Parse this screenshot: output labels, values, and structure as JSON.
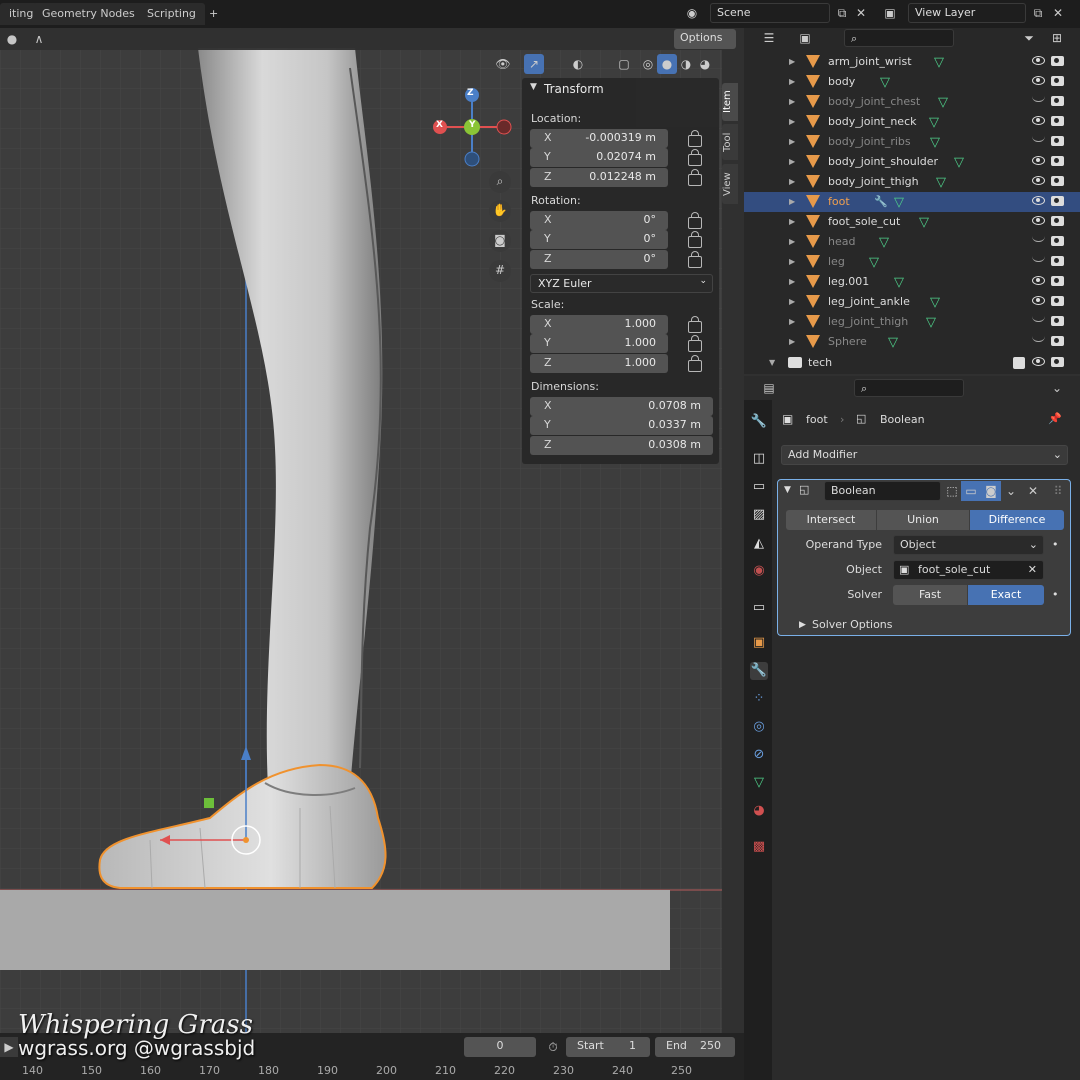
{
  "workspace_tabs": [
    "iting",
    "Geometry Nodes",
    "Scripting",
    "+"
  ],
  "scene": {
    "label": "Scene",
    "view_layer": "View Layer"
  },
  "viewport": {
    "options_label": "Options",
    "tabs": [
      "Item",
      "Tool",
      "View"
    ],
    "gizmo": {
      "z": "Z",
      "y": "Y",
      "x": "X"
    }
  },
  "transform": {
    "title": "Transform",
    "location_label": "Location:",
    "location": [
      {
        "axis": "X",
        "value": "-0.000319 m"
      },
      {
        "axis": "Y",
        "value": "0.02074 m"
      },
      {
        "axis": "Z",
        "value": "0.012248 m"
      }
    ],
    "rotation_label": "Rotation:",
    "rotation": [
      {
        "axis": "X",
        "value": "0°"
      },
      {
        "axis": "Y",
        "value": "0°"
      },
      {
        "axis": "Z",
        "value": "0°"
      }
    ],
    "rotation_mode": "XYZ Euler",
    "scale_label": "Scale:",
    "scale": [
      {
        "axis": "X",
        "value": "1.000"
      },
      {
        "axis": "Y",
        "value": "1.000"
      },
      {
        "axis": "Z",
        "value": "1.000"
      }
    ],
    "dimensions_label": "Dimensions:",
    "dimensions": [
      {
        "axis": "X",
        "value": "0.0708 m"
      },
      {
        "axis": "Y",
        "value": "0.0337 m"
      },
      {
        "axis": "Z",
        "value": "0.0308 m"
      }
    ]
  },
  "outliner": {
    "items": [
      {
        "name": "arm_joint_wrist",
        "visible": true
      },
      {
        "name": "body",
        "visible": true
      },
      {
        "name": "body_joint_chest",
        "visible": false
      },
      {
        "name": "body_joint_neck",
        "visible": true
      },
      {
        "name": "body_joint_ribs",
        "visible": false
      },
      {
        "name": "body_joint_shoulder",
        "visible": true
      },
      {
        "name": "body_joint_thigh",
        "visible": true
      },
      {
        "name": "foot",
        "visible": true,
        "selected": true
      },
      {
        "name": "foot_sole_cut",
        "visible": true
      },
      {
        "name": "head",
        "visible": false
      },
      {
        "name": "leg",
        "visible": false
      },
      {
        "name": "leg.001",
        "visible": true
      },
      {
        "name": "leg_joint_ankle",
        "visible": true
      },
      {
        "name": "leg_joint_thigh",
        "visible": false
      },
      {
        "name": "Sphere",
        "visible": false
      }
    ],
    "collection": "tech"
  },
  "properties": {
    "object": "foot",
    "modifier_crumb": "Boolean",
    "add_modifier": "Add Modifier",
    "modifier": {
      "name": "Boolean",
      "operations": [
        "Intersect",
        "Union",
        "Difference"
      ],
      "active_operation": "Difference",
      "operand_type_label": "Operand Type",
      "operand_type": "Object",
      "object_label": "Object",
      "object": "foot_sole_cut",
      "solver_label": "Solver",
      "solvers": [
        "Fast",
        "Exact"
      ],
      "active_solver": "Exact",
      "solver_options": "Solver Options"
    }
  },
  "timeline": {
    "current_frame": "0",
    "start_label": "Start",
    "start": "1",
    "end_label": "End",
    "end": "250",
    "ticks": [
      "140",
      "150",
      "160",
      "170",
      "180",
      "190",
      "200",
      "210",
      "220",
      "230",
      "240",
      "250"
    ]
  },
  "watermark": {
    "line1": "Whispering Grass",
    "line2": "wgrass.org @wgrassbjd"
  },
  "colors": {
    "accent": "#4772b3",
    "selection_outline": "#f0922e",
    "mesh_icon": "#4fd08a",
    "object_icon": "#e79a4a"
  }
}
